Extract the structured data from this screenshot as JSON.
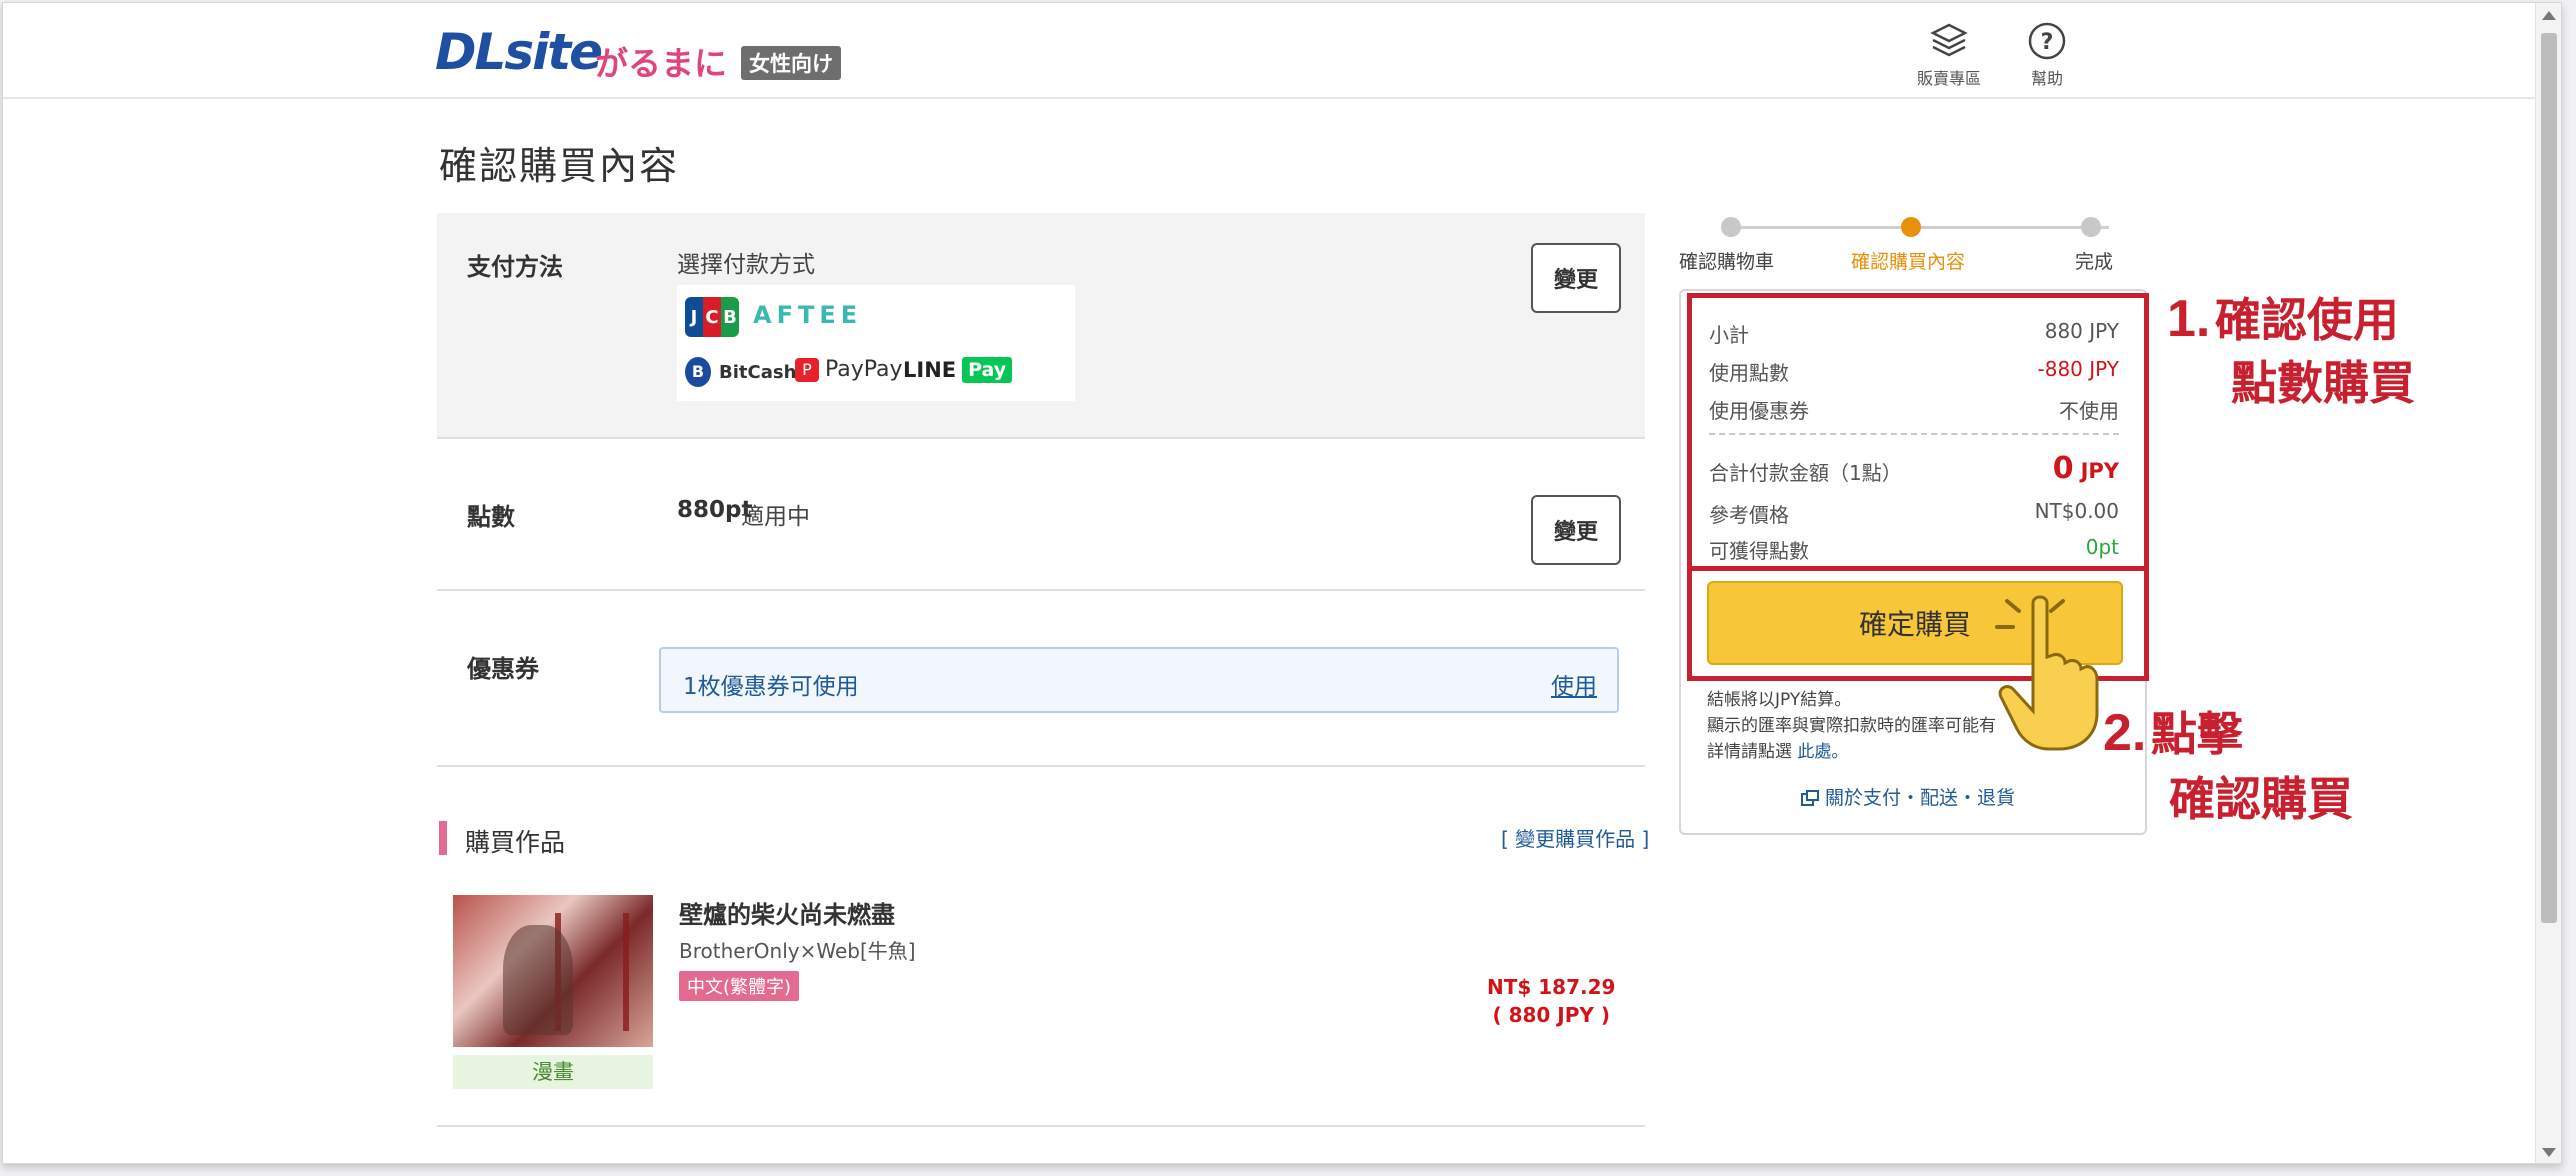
{
  "header": {
    "logo_main": "DLsite",
    "logo_sub": "がるまに",
    "logo_badge": "女性向け",
    "nav_sales": "販賣專區",
    "nav_help": "幫助"
  },
  "page": {
    "title": "確認購買內容"
  },
  "payment": {
    "label": "支付方法",
    "prompt": "選擇付款方式",
    "change": "變更",
    "logos": {
      "jcb": [
        "J",
        "C",
        "B"
      ],
      "aftee": "AFTEE",
      "bitcash": "BitCash",
      "paypay": "PayPay",
      "linepay": "LINE",
      "linepay_badge": "Pay"
    }
  },
  "points": {
    "label": "點數",
    "value": "880pt",
    "status": "適用中",
    "change": "變更"
  },
  "coupon": {
    "label": "優惠券",
    "available": "1枚優惠券可使用",
    "use": "使用"
  },
  "items": {
    "section_title": "購買作品",
    "change_link": "[ 變更購買作品 ]",
    "list": [
      {
        "title": "壁爐的柴火尚未燃盡",
        "author": "BrotherOnly×Web[牛魚]",
        "language": "中文(繁體字)",
        "genre": "漫畫",
        "price_ntd": "NT$ 187.29",
        "price_jpy": "( 880 JPY )"
      }
    ]
  },
  "steps": [
    {
      "label": "確認購物車",
      "state": "done"
    },
    {
      "label": "確認購買內容",
      "state": "current"
    },
    {
      "label": "完成",
      "state": "todo"
    }
  ],
  "summary": {
    "subtotal_label": "小計",
    "subtotal_value": "880 JPY",
    "points_label": "使用點數",
    "points_value": "-880 JPY",
    "coupon_label": "使用優惠券",
    "coupon_value": "不使用",
    "total_label": "合計付款金額（1點）",
    "total_value": "0",
    "total_unit": "JPY",
    "ref_label": "參考價格",
    "ref_value": "NT$0.00",
    "earn_label": "可獲得點數",
    "earn_value": "0pt",
    "buy_button": "確定購買",
    "note1": "結帳將以JPY結算。",
    "note2": "顯示的匯率與實際扣款時的匯率可能有",
    "note3": "詳情請點選",
    "note3_link": "此處。",
    "footer_link": "關於支付・配送・退貨"
  },
  "annotations": {
    "step1_num": "1.",
    "step1_line1": "確認使用",
    "step1_line2": "點數購買",
    "step2_num": "2.",
    "step2_line1": "點擊",
    "step2_line2": "確認購買"
  },
  "colors": {
    "accent_red": "#c8202f",
    "brand_blue": "#1f4fa0",
    "brand_pink": "#e0457b",
    "step_current": "#e8900c",
    "buy_yellow": "#f8c739",
    "point_red": "#d0141a",
    "earn_green": "#2aa83a"
  }
}
